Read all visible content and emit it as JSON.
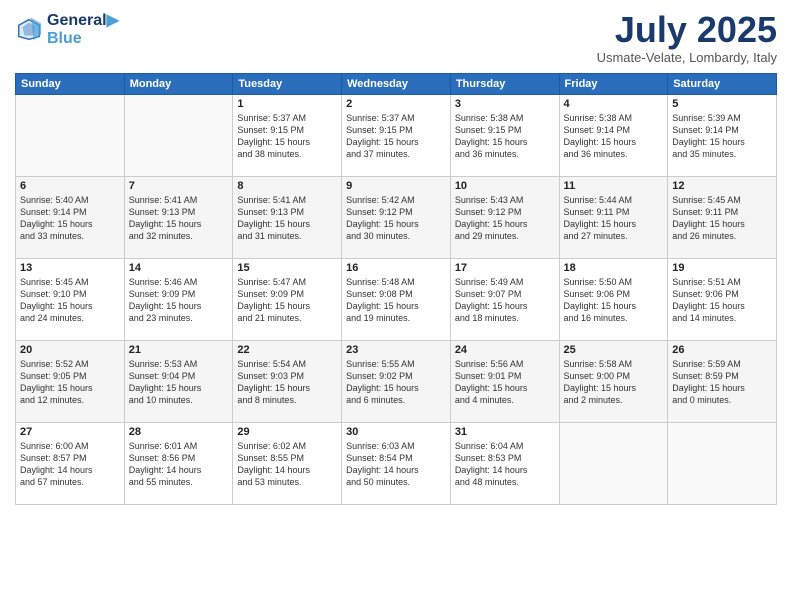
{
  "header": {
    "logo_line1": "General",
    "logo_line2": "Blue",
    "month_title": "July 2025",
    "location": "Usmate-Velate, Lombardy, Italy"
  },
  "days_of_week": [
    "Sunday",
    "Monday",
    "Tuesday",
    "Wednesday",
    "Thursday",
    "Friday",
    "Saturday"
  ],
  "weeks": [
    [
      {
        "day": "",
        "info": ""
      },
      {
        "day": "",
        "info": ""
      },
      {
        "day": "1",
        "info": "Sunrise: 5:37 AM\nSunset: 9:15 PM\nDaylight: 15 hours\nand 38 minutes."
      },
      {
        "day": "2",
        "info": "Sunrise: 5:37 AM\nSunset: 9:15 PM\nDaylight: 15 hours\nand 37 minutes."
      },
      {
        "day": "3",
        "info": "Sunrise: 5:38 AM\nSunset: 9:15 PM\nDaylight: 15 hours\nand 36 minutes."
      },
      {
        "day": "4",
        "info": "Sunrise: 5:38 AM\nSunset: 9:14 PM\nDaylight: 15 hours\nand 36 minutes."
      },
      {
        "day": "5",
        "info": "Sunrise: 5:39 AM\nSunset: 9:14 PM\nDaylight: 15 hours\nand 35 minutes."
      }
    ],
    [
      {
        "day": "6",
        "info": "Sunrise: 5:40 AM\nSunset: 9:14 PM\nDaylight: 15 hours\nand 33 minutes."
      },
      {
        "day": "7",
        "info": "Sunrise: 5:41 AM\nSunset: 9:13 PM\nDaylight: 15 hours\nand 32 minutes."
      },
      {
        "day": "8",
        "info": "Sunrise: 5:41 AM\nSunset: 9:13 PM\nDaylight: 15 hours\nand 31 minutes."
      },
      {
        "day": "9",
        "info": "Sunrise: 5:42 AM\nSunset: 9:12 PM\nDaylight: 15 hours\nand 30 minutes."
      },
      {
        "day": "10",
        "info": "Sunrise: 5:43 AM\nSunset: 9:12 PM\nDaylight: 15 hours\nand 29 minutes."
      },
      {
        "day": "11",
        "info": "Sunrise: 5:44 AM\nSunset: 9:11 PM\nDaylight: 15 hours\nand 27 minutes."
      },
      {
        "day": "12",
        "info": "Sunrise: 5:45 AM\nSunset: 9:11 PM\nDaylight: 15 hours\nand 26 minutes."
      }
    ],
    [
      {
        "day": "13",
        "info": "Sunrise: 5:45 AM\nSunset: 9:10 PM\nDaylight: 15 hours\nand 24 minutes."
      },
      {
        "day": "14",
        "info": "Sunrise: 5:46 AM\nSunset: 9:09 PM\nDaylight: 15 hours\nand 23 minutes."
      },
      {
        "day": "15",
        "info": "Sunrise: 5:47 AM\nSunset: 9:09 PM\nDaylight: 15 hours\nand 21 minutes."
      },
      {
        "day": "16",
        "info": "Sunrise: 5:48 AM\nSunset: 9:08 PM\nDaylight: 15 hours\nand 19 minutes."
      },
      {
        "day": "17",
        "info": "Sunrise: 5:49 AM\nSunset: 9:07 PM\nDaylight: 15 hours\nand 18 minutes."
      },
      {
        "day": "18",
        "info": "Sunrise: 5:50 AM\nSunset: 9:06 PM\nDaylight: 15 hours\nand 16 minutes."
      },
      {
        "day": "19",
        "info": "Sunrise: 5:51 AM\nSunset: 9:06 PM\nDaylight: 15 hours\nand 14 minutes."
      }
    ],
    [
      {
        "day": "20",
        "info": "Sunrise: 5:52 AM\nSunset: 9:05 PM\nDaylight: 15 hours\nand 12 minutes."
      },
      {
        "day": "21",
        "info": "Sunrise: 5:53 AM\nSunset: 9:04 PM\nDaylight: 15 hours\nand 10 minutes."
      },
      {
        "day": "22",
        "info": "Sunrise: 5:54 AM\nSunset: 9:03 PM\nDaylight: 15 hours\nand 8 minutes."
      },
      {
        "day": "23",
        "info": "Sunrise: 5:55 AM\nSunset: 9:02 PM\nDaylight: 15 hours\nand 6 minutes."
      },
      {
        "day": "24",
        "info": "Sunrise: 5:56 AM\nSunset: 9:01 PM\nDaylight: 15 hours\nand 4 minutes."
      },
      {
        "day": "25",
        "info": "Sunrise: 5:58 AM\nSunset: 9:00 PM\nDaylight: 15 hours\nand 2 minutes."
      },
      {
        "day": "26",
        "info": "Sunrise: 5:59 AM\nSunset: 8:59 PM\nDaylight: 15 hours\nand 0 minutes."
      }
    ],
    [
      {
        "day": "27",
        "info": "Sunrise: 6:00 AM\nSunset: 8:57 PM\nDaylight: 14 hours\nand 57 minutes."
      },
      {
        "day": "28",
        "info": "Sunrise: 6:01 AM\nSunset: 8:56 PM\nDaylight: 14 hours\nand 55 minutes."
      },
      {
        "day": "29",
        "info": "Sunrise: 6:02 AM\nSunset: 8:55 PM\nDaylight: 14 hours\nand 53 minutes."
      },
      {
        "day": "30",
        "info": "Sunrise: 6:03 AM\nSunset: 8:54 PM\nDaylight: 14 hours\nand 50 minutes."
      },
      {
        "day": "31",
        "info": "Sunrise: 6:04 AM\nSunset: 8:53 PM\nDaylight: 14 hours\nand 48 minutes."
      },
      {
        "day": "",
        "info": ""
      },
      {
        "day": "",
        "info": ""
      }
    ]
  ]
}
